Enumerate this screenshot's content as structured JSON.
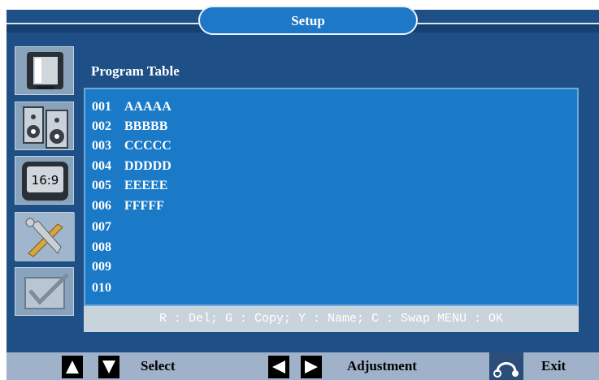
{
  "header": {
    "title": "Setup"
  },
  "sidebar": {
    "items": [
      {
        "icon": "tv-icon"
      },
      {
        "icon": "speakers-icon"
      },
      {
        "icon": "aspect-ratio-icon",
        "label": "16:9"
      },
      {
        "icon": "tools-icon"
      },
      {
        "icon": "checkmark-icon"
      }
    ]
  },
  "main": {
    "section_title": "Program Table",
    "programs": [
      {
        "num": "001",
        "name": "AAAAA"
      },
      {
        "num": "002",
        "name": "BBBBB"
      },
      {
        "num": "003",
        "name": "CCCCC"
      },
      {
        "num": "004",
        "name": "DDDDD"
      },
      {
        "num": "005",
        "name": "EEEEE"
      },
      {
        "num": "006",
        "name": "FFFFF"
      },
      {
        "num": "007",
        "name": ""
      },
      {
        "num": "008",
        "name": ""
      },
      {
        "num": "009",
        "name": ""
      },
      {
        "num": "010",
        "name": ""
      }
    ],
    "hint": "R : Del; G : Copy; Y : Name; C : Swap  MENU : OK"
  },
  "footer": {
    "select_label": "Select",
    "adjustment_label": "Adjustment",
    "exit_label": "Exit"
  },
  "colors": {
    "background": "#1e4f86",
    "table": "#1a7ac8",
    "hint_bar": "#c9d3dc",
    "footer": "#9fb2c9"
  }
}
